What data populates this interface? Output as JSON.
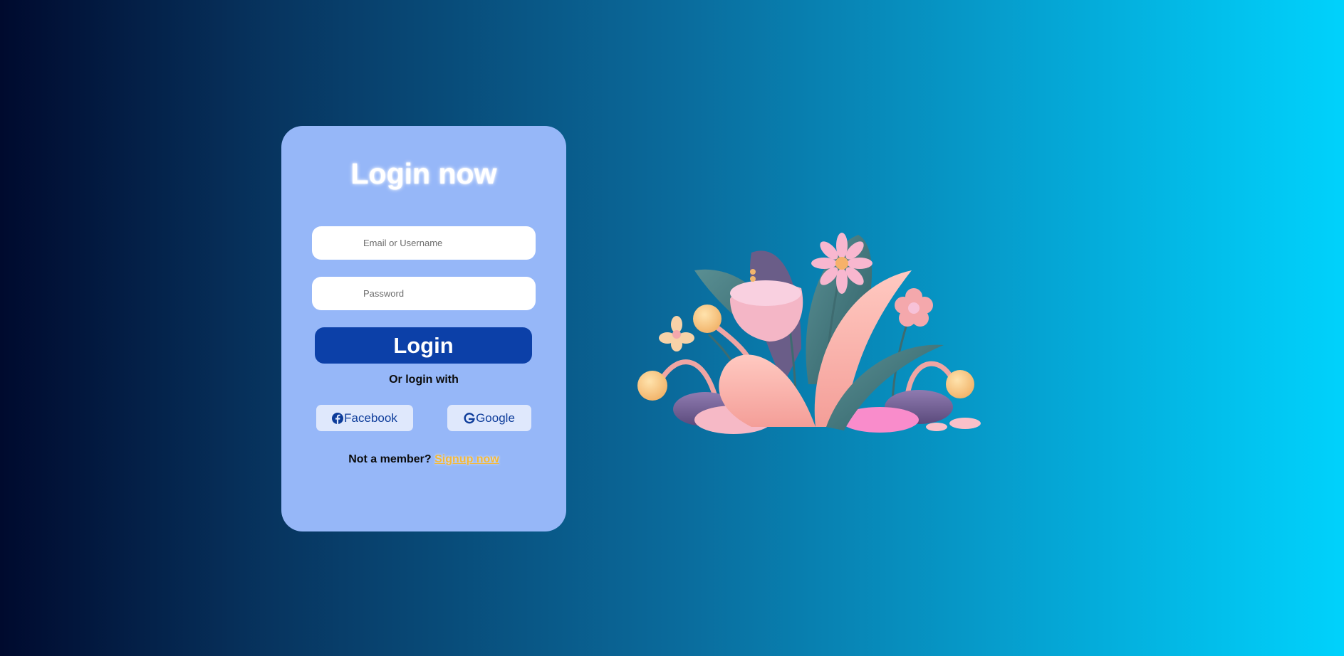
{
  "login_form": {
    "title": "Login now",
    "username_placeholder": "Email or Username",
    "password_placeholder": "Password",
    "login_label": "Login",
    "or_text": "Or login with",
    "facebook_label": "Facebook",
    "google_label": "Google",
    "member_text": "Not a member?",
    "signup_label": "Signup now"
  },
  "icons": {
    "facebook": "facebook-icon",
    "google": "google-icon",
    "illustration": "flowers-plant-illustration"
  },
  "colors": {
    "card_background": "#96b7f8",
    "login_button": "#0c40a8",
    "signup_link": "#f2b83a",
    "social_button_background": "#dfe8fc",
    "social_button_text": "#0d3c9a"
  }
}
